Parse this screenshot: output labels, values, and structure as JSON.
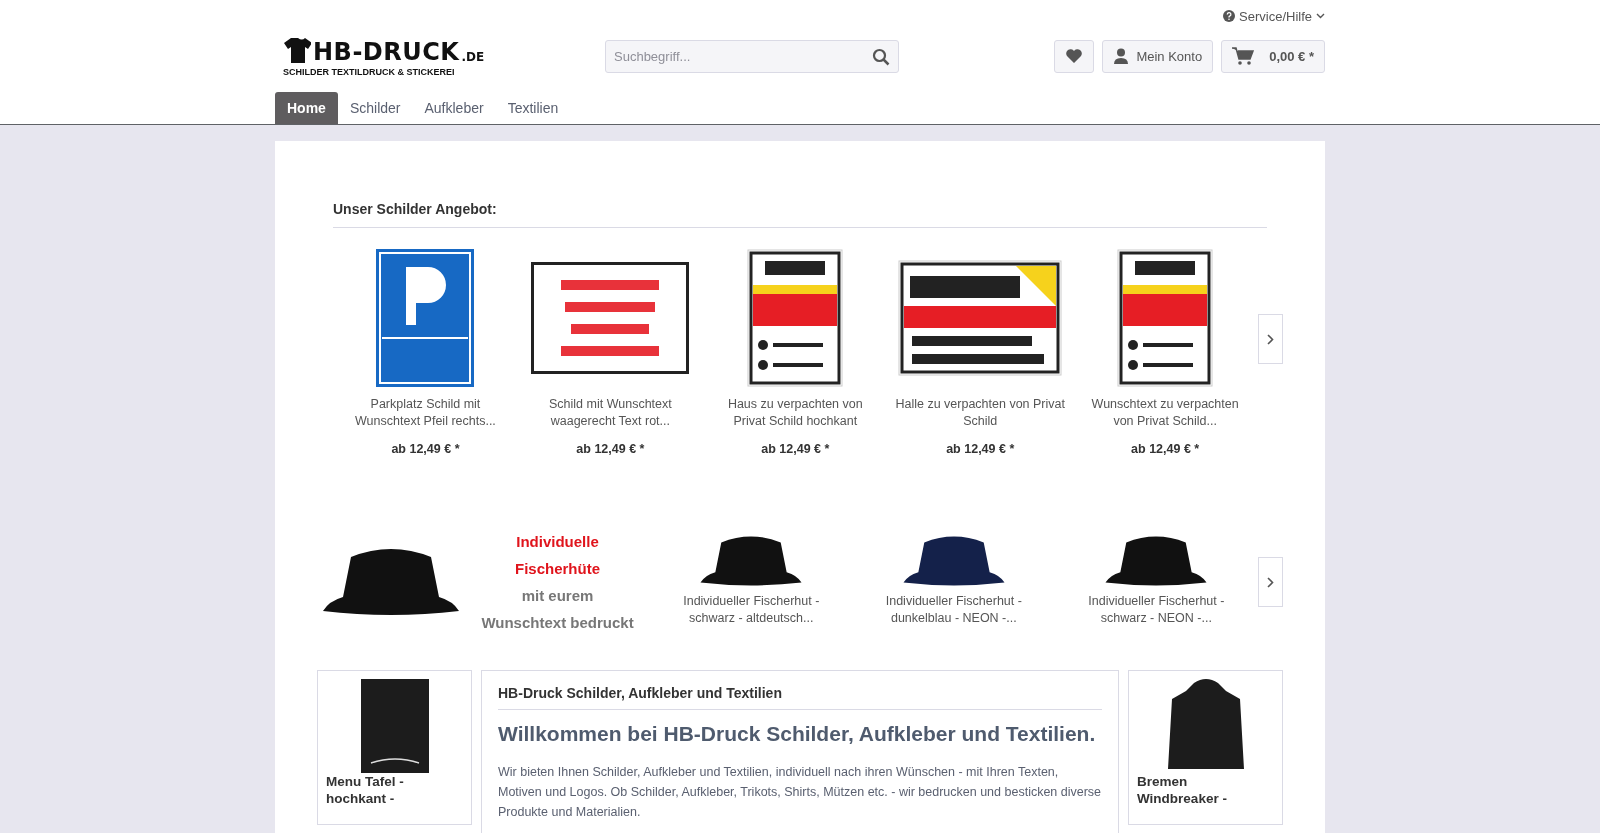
{
  "top_bar": {
    "service_link": "Service/Hilfe"
  },
  "logo": {
    "name": "HB-DRUCK",
    "domain": ".DE",
    "tagline": "SCHILDER TEXTILDRUCK & STICKEREI"
  },
  "search": {
    "placeholder": "Suchbegriff..."
  },
  "account": {
    "label": "Mein Konto"
  },
  "cart": {
    "total": "0,00 € *"
  },
  "nav": [
    {
      "label": "Home",
      "selected": true
    },
    {
      "label": "Schilder",
      "selected": false
    },
    {
      "label": "Aufkleber",
      "selected": false
    },
    {
      "label": "Textilien",
      "selected": false
    }
  ],
  "sign_slider": {
    "title": "Unser Schilder Angebot:",
    "products": [
      {
        "kind": "parking",
        "name": "Parkplatz Schild mit Wunschtext Pfeil rechts...",
        "price": "ab 12,49 € *"
      },
      {
        "kind": "landscape",
        "name": "Schild mit Wunschtext waagerecht Text rot...",
        "price": "ab 12,49 € *"
      },
      {
        "kind": "portrait",
        "name": "Haus zu verpachten von Privat Schild hochkant",
        "price": "ab 12,49 € *"
      },
      {
        "kind": "wide",
        "name": "Halle zu verpachten von Privat Schild",
        "price": "ab 12,49 € *"
      },
      {
        "kind": "portrait",
        "name": "Wunschtext zu verpachten von Privat Schild...",
        "price": "ab 12,49 € *"
      }
    ]
  },
  "hat_slider": {
    "banner": [
      {
        "kind": "accent",
        "text": "Individuelle"
      },
      {
        "kind": "accent",
        "text": "Fischerhüte"
      },
      {
        "kind": "muted",
        "text": "mit eurem"
      },
      {
        "kind": "muted",
        "text": "Wunschtext bedruckt"
      }
    ],
    "products": [
      {
        "name": "Individueller Fischerhut - schwarz - altdeutsch...",
        "color": "#111111"
      },
      {
        "name": "Individueller Fischerhut - dunkelblau - NEON -...",
        "color": "#14214a"
      },
      {
        "name": "Individueller Fischerhut - schwarz - NEON -...",
        "color": "#111111"
      }
    ]
  },
  "side_left": {
    "name": "Menu Tafel - hochkant -"
  },
  "intro": {
    "title": "HB-Druck Schilder, Aufkleber und Textilien",
    "heading": "Willkommen bei HB-Druck Schilder, Aufkleber und Textilien.",
    "text": "Wir bieten Ihnen Schilder, Aufkleber und Textilien, individuell nach ihren Wünschen - mit Ihren Texten, Motiven und Logos. Ob Schilder, Aufkleber, Trikots, Shirts, Mützen etc. - wir bedrucken und besticken diverse Produkte und Materialien."
  },
  "side_right": {
    "name": "Bremen Windbreaker -"
  }
}
